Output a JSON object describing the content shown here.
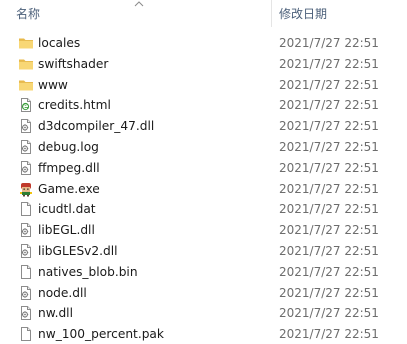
{
  "header": {
    "name_label": "名称",
    "date_label": "修改日期"
  },
  "files": [
    {
      "name": "locales",
      "date": "2021/7/27 22:51",
      "icon": "folder-icon"
    },
    {
      "name": "swiftshader",
      "date": "2021/7/27 22:51",
      "icon": "folder-icon"
    },
    {
      "name": "www",
      "date": "2021/7/27 22:51",
      "icon": "folder-icon"
    },
    {
      "name": "credits.html",
      "date": "2021/7/27 22:51",
      "icon": "html-file-icon"
    },
    {
      "name": "d3dcompiler_47.dll",
      "date": "2021/7/27 22:51",
      "icon": "dll-file-icon"
    },
    {
      "name": "debug.log",
      "date": "2021/7/27 22:51",
      "icon": "log-file-icon"
    },
    {
      "name": "ffmpeg.dll",
      "date": "2021/7/27 22:51",
      "icon": "dll-file-icon"
    },
    {
      "name": "Game.exe",
      "date": "2021/7/27 22:51",
      "icon": "game-exe-icon"
    },
    {
      "name": "icudtl.dat",
      "date": "2021/7/27 22:51",
      "icon": "blank-file-icon"
    },
    {
      "name": "libEGL.dll",
      "date": "2021/7/27 22:51",
      "icon": "dll-file-icon"
    },
    {
      "name": "libGLESv2.dll",
      "date": "2021/7/27 22:51",
      "icon": "dll-file-icon"
    },
    {
      "name": "natives_blob.bin",
      "date": "2021/7/27 22:51",
      "icon": "blank-file-icon"
    },
    {
      "name": "node.dll",
      "date": "2021/7/27 22:51",
      "icon": "dll-file-icon"
    },
    {
      "name": "nw.dll",
      "date": "2021/7/27 22:51",
      "icon": "dll-file-icon"
    },
    {
      "name": "nw_100_percent.pak",
      "date": "2021/7/27 22:51",
      "icon": "blank-file-icon"
    }
  ],
  "colors": {
    "folder": "#f8d775",
    "header_text": "#4c607a",
    "date_text": "#6d6d6d",
    "divider": "#e5e5e5"
  }
}
